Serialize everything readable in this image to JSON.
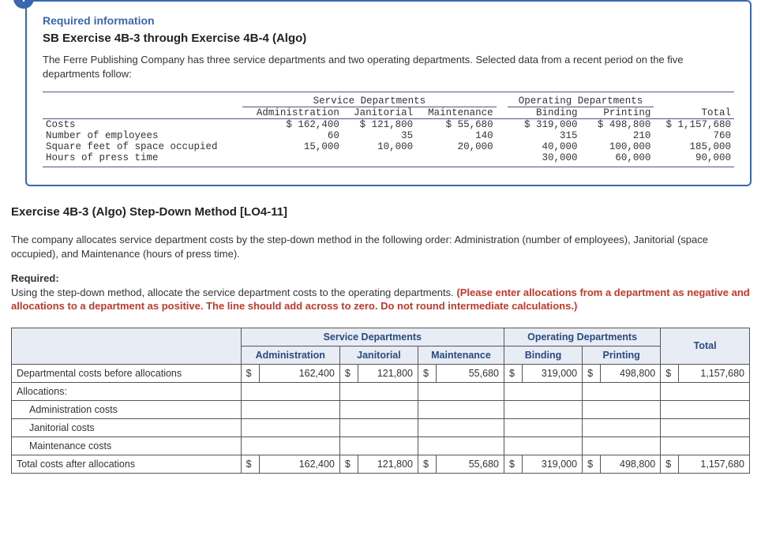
{
  "card": {
    "badge": "!",
    "required_info": "Required information",
    "title": "SB Exercise 4B-3 through Exercise 4B-4 (Algo)",
    "description": "The Ferre Publishing Company has three service departments and two operating departments. Selected data from a recent period on the five departments follow:",
    "group_service": "Service Departments",
    "group_operating": "Operating Departments",
    "cols": {
      "admin": "Administration",
      "jan": "Janitorial",
      "maint": "Maintenance",
      "bind": "Binding",
      "print": "Printing",
      "total": "Total"
    },
    "rows": {
      "costs": "Costs",
      "employees": "Number of employees",
      "sqft": "Square feet of space occupied",
      "press": "Hours of press time"
    },
    "vals": {
      "costs": {
        "admin": "$ 162,400",
        "jan": "$ 121,800",
        "maint": "$ 55,680",
        "bind": "$ 319,000",
        "print": "$ 498,800",
        "total": "$ 1,157,680"
      },
      "employees": {
        "admin": "60",
        "jan": "35",
        "maint": "140",
        "bind": "315",
        "print": "210",
        "total": "760"
      },
      "sqft": {
        "admin": "15,000",
        "jan": "10,000",
        "maint": "20,000",
        "bind": "40,000",
        "print": "100,000",
        "total": "185,000"
      },
      "press": {
        "admin": "",
        "jan": "",
        "maint": "",
        "bind": "30,000",
        "print": "60,000",
        "total": "90,000"
      }
    }
  },
  "ex": {
    "title": "Exercise 4B-3 (Algo) Step-Down Method [LO4-11]",
    "p1": "The company allocates service department costs by the step-down method in the following order: Administration (number of employees), Janitorial (space occupied), and Maintenance (hours of press time).",
    "req_label": "Required:",
    "req_text": "Using the step-down method, allocate the service department costs to the operating departments. ",
    "req_red": "(Please enter allocations from a department as negative and allocations to a department as positive. The line should add across to zero. Do not round intermediate calculations.)"
  },
  "ans": {
    "group_service": "Service Departments",
    "group_operating": "Operating Departments",
    "cols": {
      "admin": "Administration",
      "jan": "Janitorial",
      "maint": "Maintenance",
      "bind": "Binding",
      "print": "Printing",
      "total": "Total"
    },
    "rows": {
      "before": "Departmental costs before allocations",
      "alloc": "Allocations:",
      "admin": "Administration costs",
      "jan": "Janitorial costs",
      "maint": "Maintenance costs",
      "after": "Total costs after allocations"
    },
    "before": {
      "admin": "162,400",
      "jan": "121,800",
      "maint": "55,680",
      "bind": "319,000",
      "print": "498,800",
      "total": "1,157,680"
    },
    "after": {
      "admin": "162,400",
      "jan": "121,800",
      "maint": "55,680",
      "bind": "319,000",
      "print": "498,800",
      "total": "1,157,680"
    },
    "cur": "$"
  }
}
